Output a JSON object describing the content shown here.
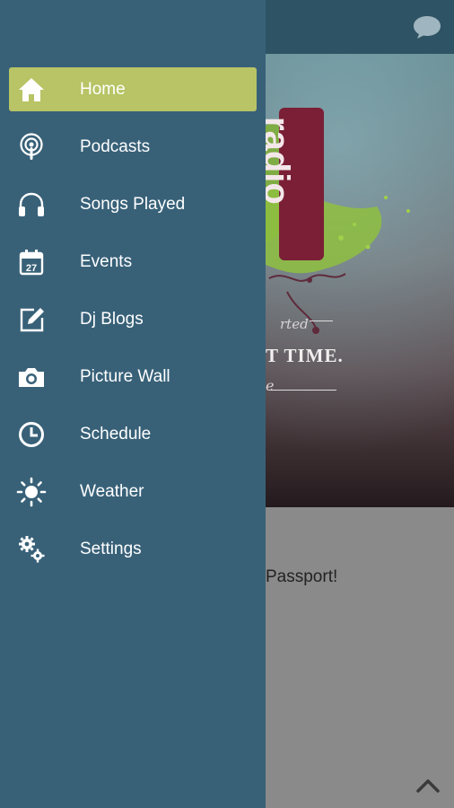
{
  "app": {
    "hero": {
      "brand_text": "radio",
      "tagline_fragment": "rted",
      "headline_fragment": "T TIME.",
      "signature_fragment": "e"
    },
    "content_text": "Passport!",
    "icons": {
      "chat": "chat-bubble-icon",
      "scroll_top": "chevron-up-icon"
    }
  },
  "drawer": {
    "items": [
      {
        "label": "Home",
        "icon": "home-icon",
        "active": true
      },
      {
        "label": "Podcasts",
        "icon": "podcast-icon",
        "active": false
      },
      {
        "label": "Songs Played",
        "icon": "headphones-icon",
        "active": false
      },
      {
        "label": "Events",
        "icon": "calendar-icon",
        "calendar_day": "27",
        "active": false
      },
      {
        "label": "Dj Blogs",
        "icon": "edit-icon",
        "active": false
      },
      {
        "label": "Picture Wall",
        "icon": "camera-icon",
        "active": false
      },
      {
        "label": "Schedule",
        "icon": "clock-icon",
        "active": false
      },
      {
        "label": "Weather",
        "icon": "sun-icon",
        "active": false
      },
      {
        "label": "Settings",
        "icon": "gears-icon",
        "active": false
      }
    ]
  },
  "colors": {
    "drawer_bg": "#386178",
    "active_item_bg": "#b8c465",
    "header_bg": "#2e5364",
    "scrim_content_bg": "#8a8a8a"
  }
}
